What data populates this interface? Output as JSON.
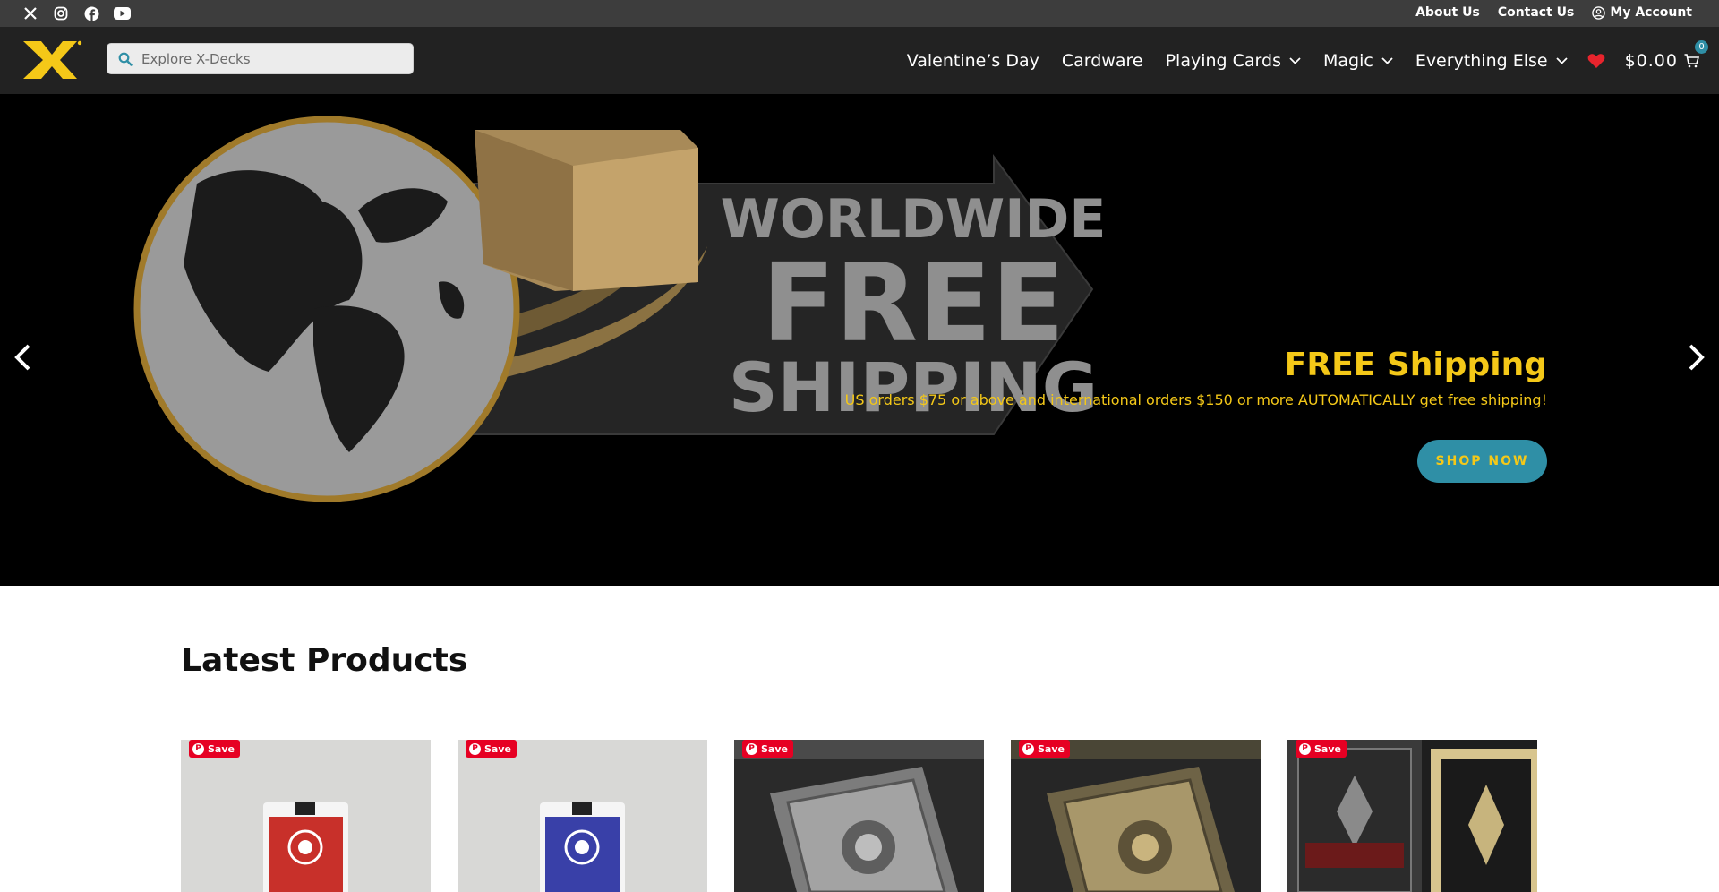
{
  "topbar": {
    "social": [
      {
        "name": "x-icon",
        "label": "X"
      },
      {
        "name": "instagram-icon",
        "label": "Instagram"
      },
      {
        "name": "facebook-icon",
        "label": "Facebook"
      },
      {
        "name": "youtube-icon",
        "label": "YouTube"
      }
    ],
    "links": {
      "about": "About Us",
      "contact": "Contact Us",
      "account": "My Account"
    }
  },
  "header": {
    "search_placeholder": "Explore X-Decks",
    "nav": {
      "valentines": "Valentine’s Day",
      "cardware": "Cardware",
      "playing_cards": "Playing Cards",
      "magic": "Magic",
      "everything_else": "Everything Else"
    },
    "cart_total": "$0.00",
    "cart_count": "0"
  },
  "hero": {
    "art_line1": "WORLDWIDE",
    "art_line2": "FREE",
    "art_line3": "SHIPPING",
    "title": "FREE Shipping",
    "text": "US orders $75 or above and international orders $150 or more AUTOMATICALLY get free shipping!",
    "button": "SHOP NOW"
  },
  "latest": {
    "title": "Latest Products",
    "save_label": "Save"
  },
  "colors": {
    "accent_yellow": "#f4c818",
    "teal": "#2f8fa6",
    "pinterest_red": "#e60023",
    "header_bg": "#222222",
    "topbar_bg": "#3d3d3d"
  }
}
